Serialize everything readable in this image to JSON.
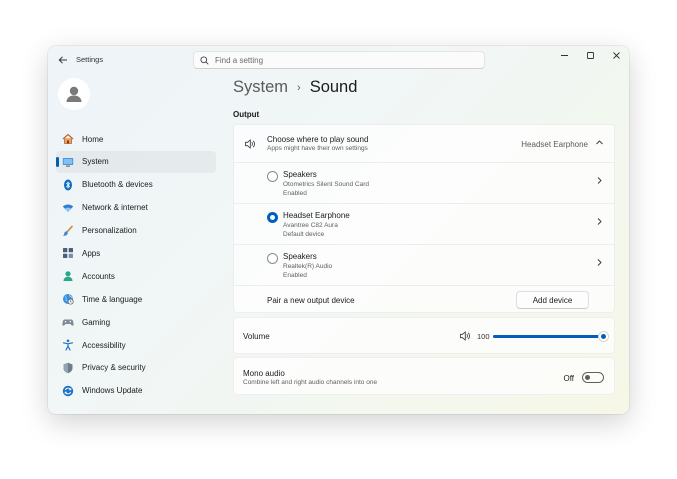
{
  "titlebar": {
    "app_title": "Settings",
    "search_placeholder": "Find a setting"
  },
  "sidebar": {
    "items": [
      {
        "label": "Home",
        "icon": "home-icon"
      },
      {
        "label": "System",
        "icon": "system-icon",
        "active": true
      },
      {
        "label": "Bluetooth & devices",
        "icon": "bluetooth-icon"
      },
      {
        "label": "Network & internet",
        "icon": "wifi-icon"
      },
      {
        "label": "Personalization",
        "icon": "brush-icon"
      },
      {
        "label": "Apps",
        "icon": "apps-icon"
      },
      {
        "label": "Accounts",
        "icon": "accounts-icon"
      },
      {
        "label": "Time & language",
        "icon": "globe-icon"
      },
      {
        "label": "Gaming",
        "icon": "gamepad-icon"
      },
      {
        "label": "Accessibility",
        "icon": "accessibility-icon"
      },
      {
        "label": "Privacy & security",
        "icon": "shield-icon"
      },
      {
        "label": "Windows Update",
        "icon": "update-icon"
      }
    ]
  },
  "main": {
    "breadcrumb_parent": "System",
    "breadcrumb_current": "Sound",
    "section_label": "Output",
    "output": {
      "title": "Choose where to play sound",
      "subtitle": "Apps might have their own settings",
      "selected_value": "Headset Earphone",
      "devices": [
        {
          "name": "Speakers",
          "detail": "Otometrics Silent Sound Card",
          "status": "Enabled",
          "selected": false
        },
        {
          "name": "Headset Earphone",
          "detail": "Avantree C82 Aura",
          "status": "Default device",
          "selected": true
        },
        {
          "name": "Speakers",
          "detail": "Realtek(R) Audio",
          "status": "Enabled",
          "selected": false
        }
      ],
      "pair_label": "Pair a new output device",
      "add_button": "Add device"
    },
    "volume": {
      "label": "Volume",
      "value": "100",
      "level_percent": 100
    },
    "mono": {
      "title": "Mono audio",
      "subtitle": "Combine left and right audio channels into one",
      "state": "Off"
    }
  },
  "colors": {
    "accent": "#005fb8"
  }
}
